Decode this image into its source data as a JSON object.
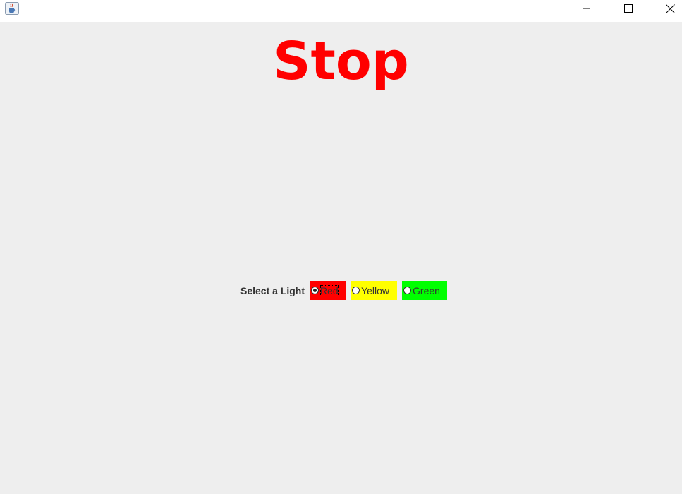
{
  "window": {
    "controls": {
      "minimize": "—",
      "maximize": "☐",
      "close": "✕"
    },
    "icon": "java-cup-icon"
  },
  "headline": {
    "text": "Stop",
    "color": "#ff0000"
  },
  "light_selector": {
    "label": "Select a Light",
    "selected": "Red",
    "options": [
      {
        "label": "Red",
        "color": "#ff0000",
        "checked": true
      },
      {
        "label": "Yellow",
        "color": "#ffff00",
        "checked": false
      },
      {
        "label": "Green",
        "color": "#00ff00",
        "checked": false
      }
    ]
  }
}
